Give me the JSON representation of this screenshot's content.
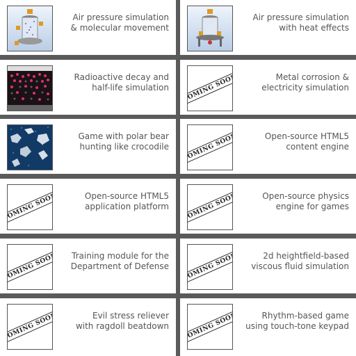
{
  "projects": [
    {
      "line1": "Air pressure simulation",
      "line2": "& molecular movement",
      "thumbnail": "air-pressure-molecules-thumbnail",
      "coming_soon": false
    },
    {
      "line1": "Air pressure simulation",
      "line2": "with heat effects",
      "thumbnail": "air-pressure-heat-thumbnail",
      "coming_soon": false
    },
    {
      "line1": "Radioactive decay and",
      "line2": "half-life simulation",
      "thumbnail": "radioactive-decay-thumbnail",
      "coming_soon": false
    },
    {
      "line1": "Metal corrosion &",
      "line2": "electricity simulation",
      "thumbnail": "coming-soon-stamp",
      "coming_soon": true
    },
    {
      "line1": "Game with polar bear",
      "line2": "hunting like crocodile",
      "thumbnail": "polar-bear-game-thumbnail",
      "coming_soon": false
    },
    {
      "line1": "Open-source HTML5",
      "line2": "content engine",
      "thumbnail": "coming-soon-stamp",
      "coming_soon": true
    },
    {
      "line1": "Open-source HTML5",
      "line2": "application platform",
      "thumbnail": "coming-soon-stamp",
      "coming_soon": true
    },
    {
      "line1": "Open-source physics",
      "line2": "engine for games",
      "thumbnail": "coming-soon-stamp",
      "coming_soon": true
    },
    {
      "line1": "Training module for the",
      "line2": "Department of Defense",
      "thumbnail": "coming-soon-stamp",
      "coming_soon": true
    },
    {
      "line1": "2d heightfield-based",
      "line2": "viscous fluid simulation",
      "thumbnail": "coming-soon-stamp",
      "coming_soon": true
    },
    {
      "line1": "Evil stress reliever",
      "line2": "with ragdoll beatdown",
      "thumbnail": "coming-soon-stamp",
      "coming_soon": true
    },
    {
      "line1": "Rhythm-based game",
      "line2": "using touch-tone keypad",
      "thumbnail": "coming-soon-stamp",
      "coming_soon": true
    }
  ],
  "coming_soon_label": "COMING SOON",
  "colors": {
    "background": "#5a5a5a",
    "tile": "#ffffff",
    "caption": "#555555"
  }
}
